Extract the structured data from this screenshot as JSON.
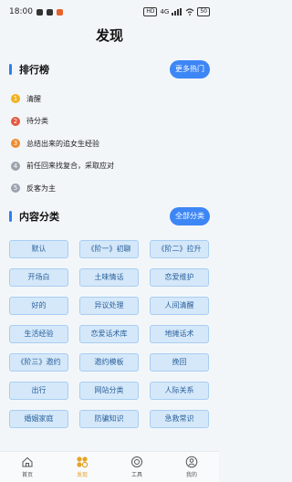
{
  "status_bar": {
    "time": "18:00",
    "net_label": "4G",
    "battery": "50"
  },
  "page_title": "发现",
  "hot": {
    "title": "排行榜",
    "more_label": "更多热门",
    "items": [
      {
        "num": "1",
        "color": "#f0b21f",
        "text": "清醒"
      },
      {
        "num": "2",
        "color": "#e4573f",
        "text": "待分类"
      },
      {
        "num": "3",
        "color": "#ef8a2a",
        "text": "总结出来的追女生经验"
      },
      {
        "num": "4",
        "color": "#9aa3ad",
        "text": "前任回来找复合，采取应对"
      },
      {
        "num": "5",
        "color": "#9aa3ad",
        "text": "反客为主"
      }
    ]
  },
  "categories": {
    "title": "内容分类",
    "all_label": "全部分类",
    "items": [
      "默认",
      "《阶一》初聊",
      "《阶二》拉升",
      "开场白",
      "土味情话",
      "恋爱维护",
      "好的",
      "异议处理",
      "人间清醒",
      "生活经验",
      "恋爱话术库",
      "地摊话术",
      "《阶三》邀约",
      "邀约模板",
      "挽回",
      "出行",
      "网站分类",
      "人际关系",
      "婚姻家庭",
      "防骗知识",
      "急救常识"
    ]
  },
  "tabbar": {
    "items": [
      {
        "label": "首页",
        "icon": "home-icon",
        "active": false
      },
      {
        "label": "发现",
        "icon": "discover-icon",
        "active": true
      },
      {
        "label": "工具",
        "icon": "tools-icon",
        "active": false
      },
      {
        "label": "我的",
        "icon": "profile-icon",
        "active": false
      }
    ],
    "active_color": "#e6a324"
  },
  "accent_color": "#2f7fee"
}
